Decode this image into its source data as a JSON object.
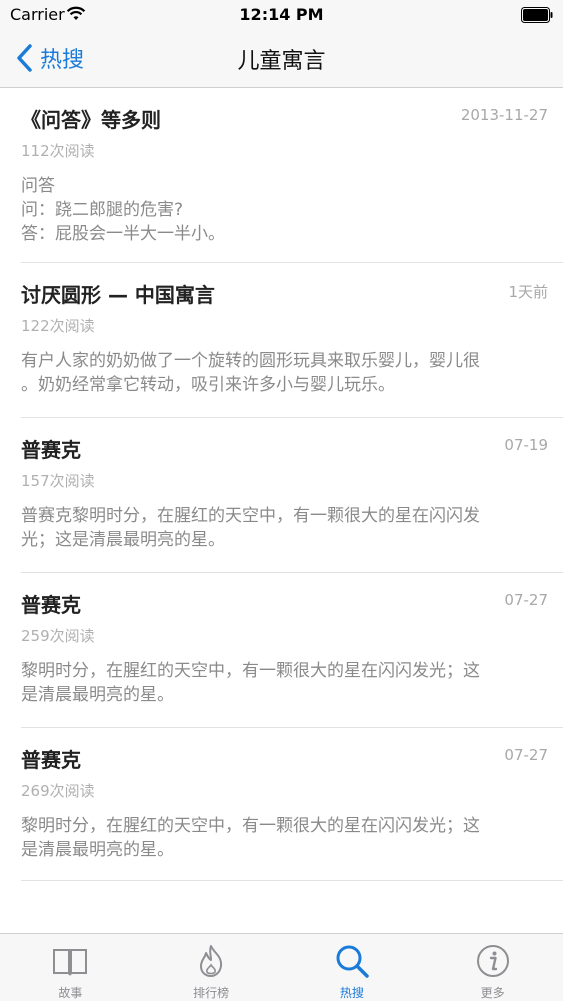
{
  "status_bar": {
    "carrier": "Carrier",
    "time": "12:14 PM"
  },
  "nav": {
    "back_label": "热搜",
    "title": "儿童寓言"
  },
  "articles": [
    {
      "title": "《问答》等多则",
      "date": "2013-11-27",
      "reads": "112次阅读",
      "body": [
        "问答",
        "问：跷二郎腿的危害?",
        "答：屁股会一半大一半小。"
      ]
    },
    {
      "title": "讨厌圆形 — 中国寓言",
      "date": "1天前",
      "reads": "122次阅读",
      "body": [
        "有户人家的奶奶做了一个旋转的圆形玩具来取乐婴儿，婴儿很",
        "。奶奶经常拿它转动，吸引来许多小与婴儿玩乐。"
      ]
    },
    {
      "title": "普赛克",
      "date": "07-19",
      "reads": "157次阅读",
      "body": [
        "普赛克黎明时分，在腥红的天空中，有一颗很大的星在闪闪发",
        "光；这是清晨最明亮的星。"
      ]
    },
    {
      "title": "普赛克",
      "date": "07-27",
      "reads": "259次阅读",
      "body": [
        "黎明时分，在腥红的天空中，有一颗很大的星在闪闪发光；这",
        "是清晨最明亮的星。"
      ]
    },
    {
      "title": "普赛克",
      "date": "07-27",
      "reads": "269次阅读",
      "body": [
        "黎明时分，在腥红的天空中，有一颗很大的星在闪闪发光；这",
        "是清晨最明亮的星。"
      ]
    }
  ],
  "tabs": [
    {
      "label": "故事",
      "icon": "book-icon",
      "active": false
    },
    {
      "label": "排行榜",
      "icon": "flame-icon",
      "active": false
    },
    {
      "label": "热搜",
      "icon": "search-icon",
      "active": true
    },
    {
      "label": "更多",
      "icon": "info-icon",
      "active": false
    }
  ],
  "colors": {
    "accent": "#1a7bd9",
    "inactive_tab": "#8e8e93",
    "bar_background": "#f7f7f7"
  }
}
